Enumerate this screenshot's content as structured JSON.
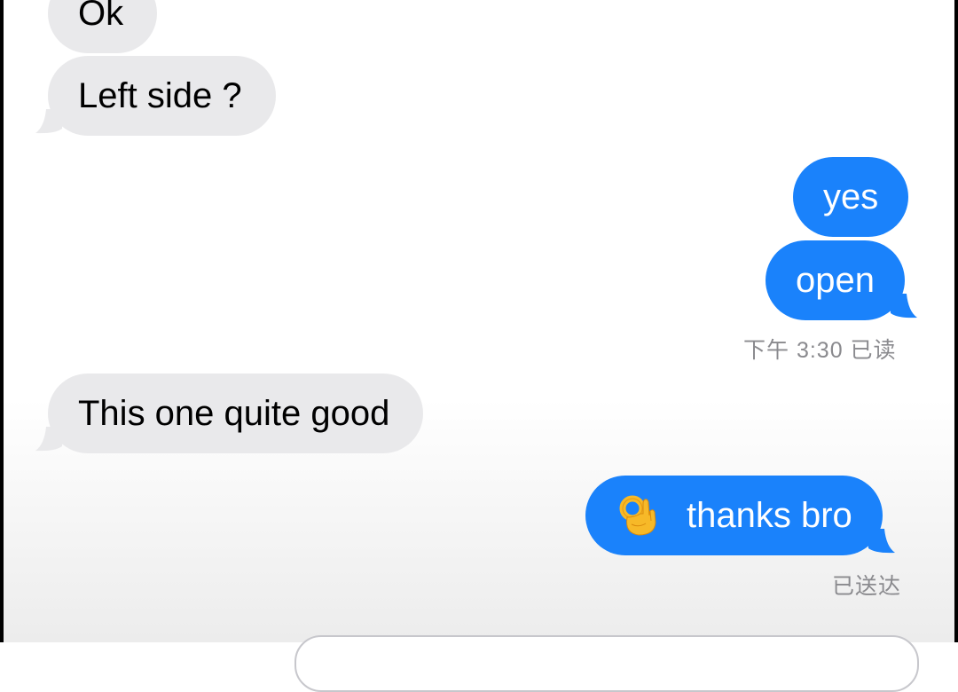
{
  "conversation": {
    "messages": [
      {
        "direction": "incoming",
        "text": "Ok"
      },
      {
        "direction": "incoming",
        "text": "Left side ?"
      },
      {
        "direction": "outgoing",
        "text": "yes"
      },
      {
        "direction": "outgoing",
        "text": "open"
      },
      {
        "direction": "incoming",
        "text": "This one quite good"
      },
      {
        "direction": "outgoing",
        "emoji": "ok-hand",
        "text": "thanks bro"
      }
    ],
    "read_receipt": "下午 3:30 已读",
    "delivered_receipt": "已送达"
  },
  "colors": {
    "incoming_bubble": "#e9e9eb",
    "outgoing_bubble": "#1a82fb",
    "receipt_text": "#8a8a8e"
  }
}
